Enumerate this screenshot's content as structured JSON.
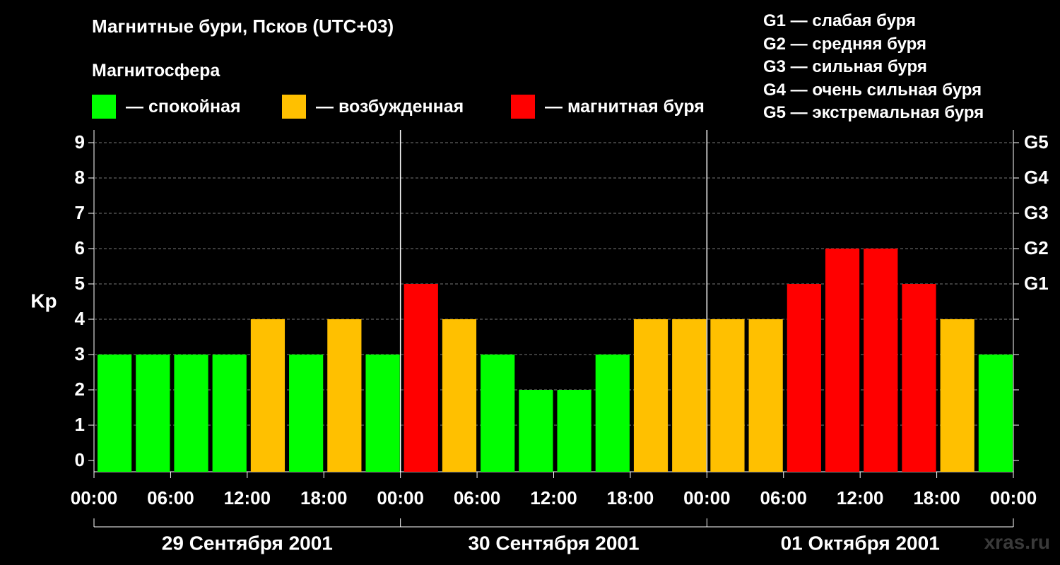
{
  "header": {
    "title": "Магнитные бури, Псков (UTC+03)",
    "subtitle": "Магнитосфера"
  },
  "legend": [
    {
      "label": "— спокойная",
      "color": "#00ff00"
    },
    {
      "label": "— возбужденная",
      "color": "#ffc000"
    },
    {
      "label": "— магнитная буря",
      "color": "#ff0000"
    }
  ],
  "storm_scale": [
    "G1 — слабая буря",
    "G2 — средняя буря",
    "G3 — сильная буря",
    "G4 — очень сильная буря",
    "G5 — экстремальная буря"
  ],
  "watermark": "xras.ru",
  "chart_data": {
    "type": "bar",
    "ylabel": "Kp",
    "ylim": [
      0,
      9
    ],
    "yticks": [
      "0",
      "1",
      "2",
      "3",
      "4",
      "5",
      "6",
      "7",
      "8",
      "9"
    ],
    "right_ticks": [
      {
        "level": 5,
        "label": "G1"
      },
      {
        "level": 6,
        "label": "G2"
      },
      {
        "level": 7,
        "label": "G3"
      },
      {
        "level": 8,
        "label": "G4"
      },
      {
        "level": 9,
        "label": "G5"
      }
    ],
    "xtick_labels": [
      "00:00",
      "06:00",
      "12:00",
      "18:00",
      "00:00",
      "06:00",
      "12:00",
      "18:00",
      "00:00",
      "06:00",
      "12:00",
      "18:00",
      "00:00"
    ],
    "days": [
      "29 Сентября 2001",
      "30 Сентября 2001",
      "01 Октября 2001"
    ],
    "bars_per_day": 8,
    "values": [
      3,
      3,
      3,
      3,
      4,
      3,
      4,
      3,
      5,
      4,
      3,
      2,
      2,
      3,
      4,
      4,
      4,
      4,
      5,
      6,
      6,
      5,
      4,
      3
    ],
    "colors": {
      "quiet": "#00ff00",
      "active": "#ffc000",
      "storm": "#ff0000"
    },
    "thresholds": {
      "active": 4,
      "storm": 5
    },
    "grid": true
  }
}
